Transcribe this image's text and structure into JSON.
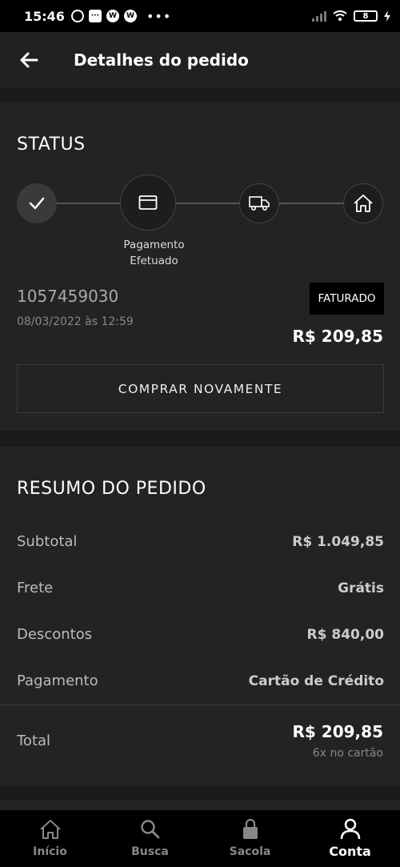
{
  "status_bar": {
    "time": "15:46",
    "icons": [
      "alarm-icon",
      "chat-icon",
      "app-icon",
      "app-icon",
      "more-dots"
    ],
    "battery": "8"
  },
  "header": {
    "title": "Detalhes do pedido"
  },
  "status": {
    "title": "STATUS",
    "steps": [
      {
        "icon": "check-icon",
        "state": "done"
      },
      {
        "icon": "card-icon",
        "state": "current",
        "label": "Pagamento Efetuado"
      },
      {
        "icon": "truck-icon",
        "state": "pending"
      },
      {
        "icon": "home-icon",
        "state": "pending"
      }
    ],
    "step_label_line1": "Pagamento",
    "step_label_line2": "Efetuado",
    "order_number": "1057459030",
    "order_date": "08/03/2022 às 12:59",
    "badge": "FATURADO",
    "order_total": "R$ 209,85",
    "buy_again_label": "COMPRAR NOVAMENTE"
  },
  "summary": {
    "title": "RESUMO DO PEDIDO",
    "rows": [
      {
        "label": "Subtotal",
        "value": "R$ 1.049,85"
      },
      {
        "label": "Frete",
        "value": "Grátis"
      },
      {
        "label": "Descontos",
        "value": "R$ 840,00"
      },
      {
        "label": "Pagamento",
        "value": "Cartão de Crédito"
      }
    ],
    "total_label": "Total",
    "total_value": "R$ 209,85",
    "installments": "6x no cartão"
  },
  "nav": {
    "items": [
      {
        "label": "Início",
        "icon": "home-icon",
        "active": false
      },
      {
        "label": "Busca",
        "icon": "search-icon",
        "active": false
      },
      {
        "label": "Sacola",
        "icon": "bag-icon",
        "active": false
      },
      {
        "label": "Conta",
        "icon": "user-icon",
        "active": true
      }
    ]
  },
  "colors": {
    "background": "#1b1b1b",
    "card": "#232323",
    "badge_bg": "#000000",
    "text_primary": "#ffffff",
    "text_muted": "#aaaaaa"
  }
}
